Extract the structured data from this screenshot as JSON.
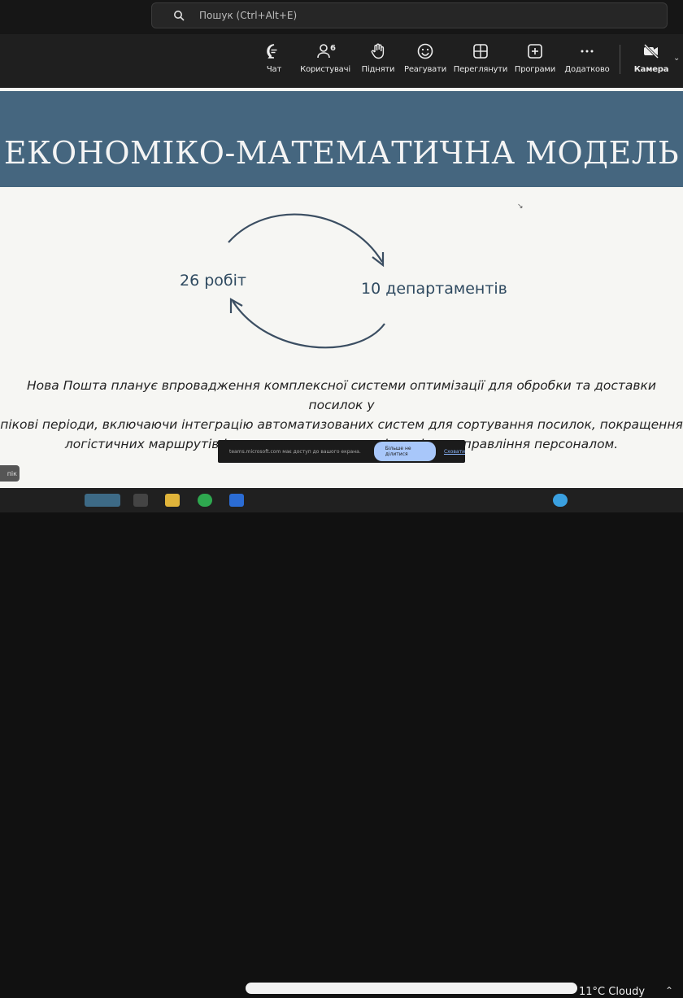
{
  "search": {
    "placeholder": "Пошук (Ctrl+Alt+E)"
  },
  "toolbar": {
    "items": [
      {
        "label": "Чат",
        "icon": "chat-icon"
      },
      {
        "label": "Користувачі",
        "icon": "people-icon",
        "badge": "6"
      },
      {
        "label": "Підняти",
        "icon": "raise-hand-icon"
      },
      {
        "label": "Реагувати",
        "icon": "react-icon"
      },
      {
        "label": "Переглянути",
        "icon": "view-icon"
      },
      {
        "label": "Програми",
        "icon": "apps-icon"
      },
      {
        "label": "Додатково",
        "icon": "more-icon"
      },
      {
        "label": "Камера",
        "icon": "camera-off-icon"
      }
    ]
  },
  "slide": {
    "title": "ЕКОНОМІКО-МАТЕМАТИЧНА МОДЕЛЬ",
    "left_label": "26 робіт",
    "right_label": "10 департаментів",
    "paragraph": [
      "Нова Пошта планує впровадження комплексної системи оптимізації для обробки та доставки посилок у",
      "пікові періоди, включаючи інтеграцію автоматизованих систем для сортування посилок, покращення",
      "логістичних маршрутів і впровадження нових підходів до управління персоналом."
    ]
  },
  "notice": {
    "text": "teams.microsoft.com має доступ до вашого екрана.",
    "button": "Більше не ділитися",
    "hide": "Сховати"
  },
  "left_chip": "пік",
  "taskbar": {
    "weather": "11°C  Cloudy"
  },
  "colors": {
    "banner": "#45667f",
    "toolbar": "#1f1f1f",
    "slide_bg": "#f6f6f3",
    "accent": "#a8c7fa"
  }
}
